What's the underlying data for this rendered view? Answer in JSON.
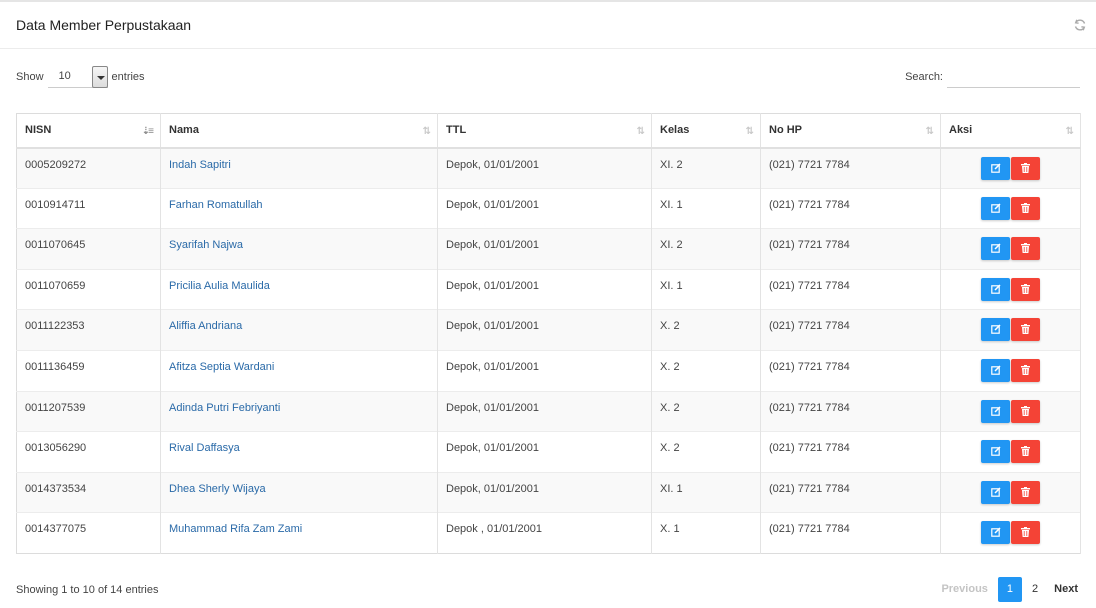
{
  "panel": {
    "title": "Data Member Perpustakaan"
  },
  "length": {
    "show_label": "Show",
    "value": "10",
    "entries_label": "entries"
  },
  "search": {
    "label": "Search:",
    "value": ""
  },
  "table": {
    "columns": [
      "NISN",
      "Nama",
      "TTL",
      "Kelas",
      "No HP",
      "Aksi"
    ],
    "rows": [
      {
        "nisn": "0005209272",
        "nama": "Indah Sapitri",
        "ttl": "Depok,  01/01/2001",
        "kelas": "XI. 2",
        "hp": "(021) 7721 7784"
      },
      {
        "nisn": "0010914711",
        "nama": "Farhan Romatullah",
        "ttl": "Depok,  01/01/2001",
        "kelas": "XI. 1",
        "hp": "(021) 7721 7784"
      },
      {
        "nisn": "0011070645",
        "nama": "Syarifah Najwa",
        "ttl": "Depok,  01/01/2001",
        "kelas": "XI. 2",
        "hp": "(021) 7721 7784"
      },
      {
        "nisn": "0011070659",
        "nama": "Pricilia Aulia Maulida",
        "ttl": "Depok,  01/01/2001",
        "kelas": "XI. 1",
        "hp": "(021) 7721 7784"
      },
      {
        "nisn": "0011122353",
        "nama": "Aliffia Andriana",
        "ttl": "Depok,  01/01/2001",
        "kelas": "X. 2",
        "hp": "(021) 7721 7784"
      },
      {
        "nisn": "0011136459",
        "nama": "Afitza Septia Wardani",
        "ttl": "Depok,  01/01/2001",
        "kelas": "X. 2",
        "hp": "(021) 7721 7784"
      },
      {
        "nisn": "0011207539",
        "nama": "Adinda Putri Febriyanti",
        "ttl": "Depok,  01/01/2001",
        "kelas": "X. 2",
        "hp": "(021) 7721 7784"
      },
      {
        "nisn": "0013056290",
        "nama": "Rival Daffasya",
        "ttl": "Depok,  01/01/2001",
        "kelas": "X. 2",
        "hp": "(021) 7721 7784"
      },
      {
        "nisn": "0014373534",
        "nama": "Dhea Sherly Wijaya",
        "ttl": "Depok,  01/01/2001",
        "kelas": "XI. 1",
        "hp": "(021) 7721 7784"
      },
      {
        "nisn": "0014377075",
        "nama": "Muhammad Rifa Zam Zami",
        "ttl": "Depok ,  01/01/2001",
        "kelas": "X. 1",
        "hp": "(021) 7721 7784"
      }
    ]
  },
  "footer": {
    "info": "Showing 1 to 10 of 14 entries",
    "previous": "Previous",
    "pages": [
      "1",
      "2"
    ],
    "current_page": "1",
    "next": "Next"
  },
  "icons": {
    "refresh": "refresh-icon",
    "edit": "edit-icon",
    "delete": "trash-icon"
  },
  "colors": {
    "primary": "#2196f3",
    "danger": "#f44336",
    "link": "#2a6aa8"
  }
}
